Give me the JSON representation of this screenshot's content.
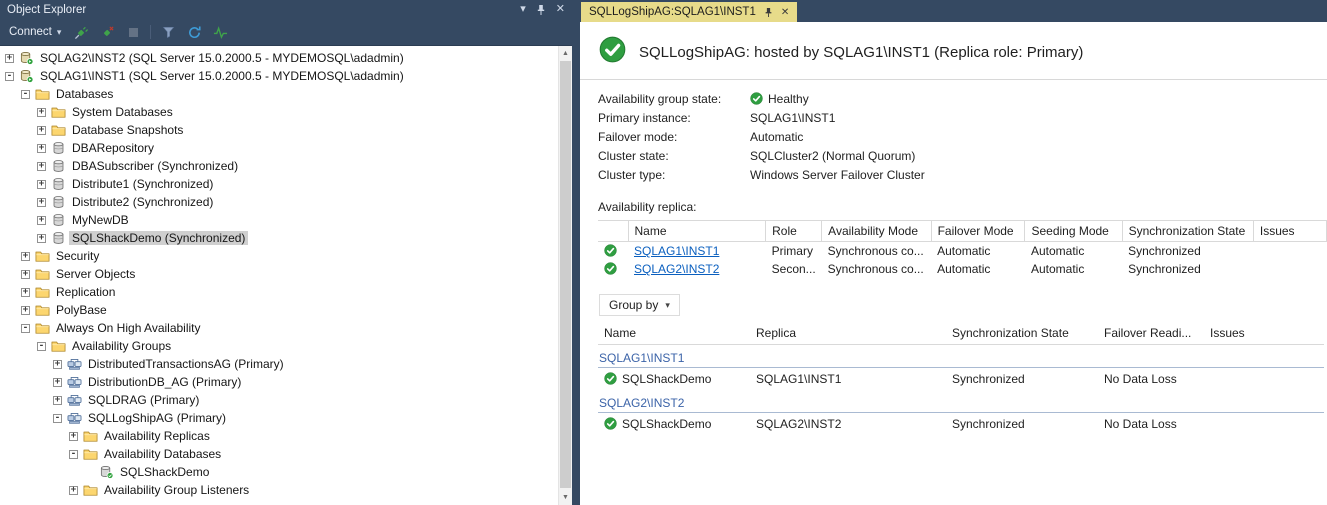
{
  "colors": {
    "chrome": "#354962",
    "active_tab": "#e7db8a",
    "healthy_green": "#2f9e41",
    "link_blue": "#0a5fbf"
  },
  "object_explorer": {
    "title": "Object Explorer",
    "titlebar_icons": [
      "window-position-icon",
      "pin-icon",
      "close-icon"
    ],
    "toolbar": {
      "connect_label": "Connect",
      "icons": [
        "connect-icon",
        "disconnect-icon",
        "stop-icon",
        "filter-icon",
        "refresh-icon",
        "activity-monitor-icon"
      ]
    },
    "tree": [
      {
        "label": "SQLAG2\\INST2 (SQL Server 15.0.2000.5 - MYDEMOSQL\\adadmin)",
        "level": 0,
        "glyph": "plus",
        "icon": "server"
      },
      {
        "label": "SQLAG1\\INST1 (SQL Server 15.0.2000.5 - MYDEMOSQL\\adadmin)",
        "level": 0,
        "glyph": "minus",
        "icon": "server"
      },
      {
        "label": "Databases",
        "level": 1,
        "glyph": "minus",
        "icon": "folder"
      },
      {
        "label": "System Databases",
        "level": 2,
        "glyph": "plus",
        "icon": "folder"
      },
      {
        "label": "Database Snapshots",
        "level": 2,
        "glyph": "plus",
        "icon": "folder"
      },
      {
        "label": "DBARepository",
        "level": 2,
        "glyph": "plus",
        "icon": "db"
      },
      {
        "label": "DBASubscriber (Synchronized)",
        "level": 2,
        "glyph": "plus",
        "icon": "db"
      },
      {
        "label": "Distribute1 (Synchronized)",
        "level": 2,
        "glyph": "plus",
        "icon": "db"
      },
      {
        "label": "Distribute2 (Synchronized)",
        "level": 2,
        "glyph": "plus",
        "icon": "db"
      },
      {
        "label": "MyNewDB",
        "level": 2,
        "glyph": "plus",
        "icon": "db"
      },
      {
        "label": "SQLShackDemo (Synchronized)",
        "level": 2,
        "glyph": "plus",
        "icon": "db",
        "selected": true
      },
      {
        "label": "Security",
        "level": 1,
        "glyph": "plus",
        "icon": "folder"
      },
      {
        "label": "Server Objects",
        "level": 1,
        "glyph": "plus",
        "icon": "folder"
      },
      {
        "label": "Replication",
        "level": 1,
        "glyph": "plus",
        "icon": "folder"
      },
      {
        "label": "PolyBase",
        "level": 1,
        "glyph": "plus",
        "icon": "folder"
      },
      {
        "label": "Always On High Availability",
        "level": 1,
        "glyph": "minus",
        "icon": "folder"
      },
      {
        "label": "Availability Groups",
        "level": 2,
        "glyph": "minus",
        "icon": "folder"
      },
      {
        "label": "DistributedTransactionsAG (Primary)",
        "level": 3,
        "glyph": "plus",
        "icon": "ag"
      },
      {
        "label": "DistributionDB_AG (Primary)",
        "level": 3,
        "glyph": "plus",
        "icon": "ag"
      },
      {
        "label": "SQLDRAG (Primary)",
        "level": 3,
        "glyph": "plus",
        "icon": "ag"
      },
      {
        "label": "SQLLogShipAG (Primary)",
        "level": 3,
        "glyph": "minus",
        "icon": "ag"
      },
      {
        "label": "Availability Replicas",
        "level": 4,
        "glyph": "plus",
        "icon": "folder"
      },
      {
        "label": "Availability Databases",
        "level": 4,
        "glyph": "minus",
        "icon": "folder"
      },
      {
        "label": "SQLShackDemo",
        "level": 5,
        "glyph": "none",
        "icon": "dbgreen"
      },
      {
        "label": "Availability Group Listeners",
        "level": 4,
        "glyph": "plus",
        "icon": "folder"
      }
    ]
  },
  "dashboard": {
    "tab_title": "SQLLogShipAG:SQLAG1\\INST1",
    "header_title": "SQLLogShipAG: hosted by SQLAG1\\INST1 (Replica role: Primary)",
    "details": [
      {
        "label": "Availability group state:",
        "value": "Healthy",
        "healthy": true
      },
      {
        "label": "Primary instance:",
        "value": "SQLAG1\\INST1"
      },
      {
        "label": "Failover mode:",
        "value": "Automatic"
      },
      {
        "label": "Cluster state:",
        "value": "SQLCluster2 (Normal Quorum)"
      },
      {
        "label": "Cluster type:",
        "value": "Windows Server Failover Cluster"
      }
    ],
    "replica_section": {
      "label": "Availability replica:",
      "columns": [
        "Name",
        "Role",
        "Availability Mode",
        "Failover Mode",
        "Seeding Mode",
        "Synchronization State",
        "Issues"
      ],
      "rows": [
        {
          "name": "SQLAG1\\INST1",
          "role": "Primary",
          "availability_mode": "Synchronous co...",
          "failover_mode": "Automatic",
          "seeding_mode": "Automatic",
          "synchronization_state": "Synchronized",
          "issues": ""
        },
        {
          "name": "SQLAG2\\INST2",
          "role": "Secon...",
          "availability_mode": "Synchronous co...",
          "failover_mode": "Automatic",
          "seeding_mode": "Automatic",
          "synchronization_state": "Synchronized",
          "issues": ""
        }
      ]
    },
    "group_by_label": "Group by",
    "database_section": {
      "columns": [
        "Name",
        "Replica",
        "Synchronization State",
        "Failover Readi...",
        "Issues"
      ],
      "groups": [
        {
          "group": "SQLAG1\\INST1",
          "rows": [
            {
              "name": "SQLShackDemo",
              "replica": "SQLAG1\\INST1",
              "synchronization_state": "Synchronized",
              "failover_readiness": "No Data Loss",
              "issues": ""
            }
          ]
        },
        {
          "group": "SQLAG2\\INST2",
          "rows": [
            {
              "name": "SQLShackDemo",
              "replica": "SQLAG2\\INST2",
              "synchronization_state": "Synchronized",
              "failover_readiness": "No Data Loss",
              "issues": ""
            }
          ]
        }
      ]
    }
  }
}
